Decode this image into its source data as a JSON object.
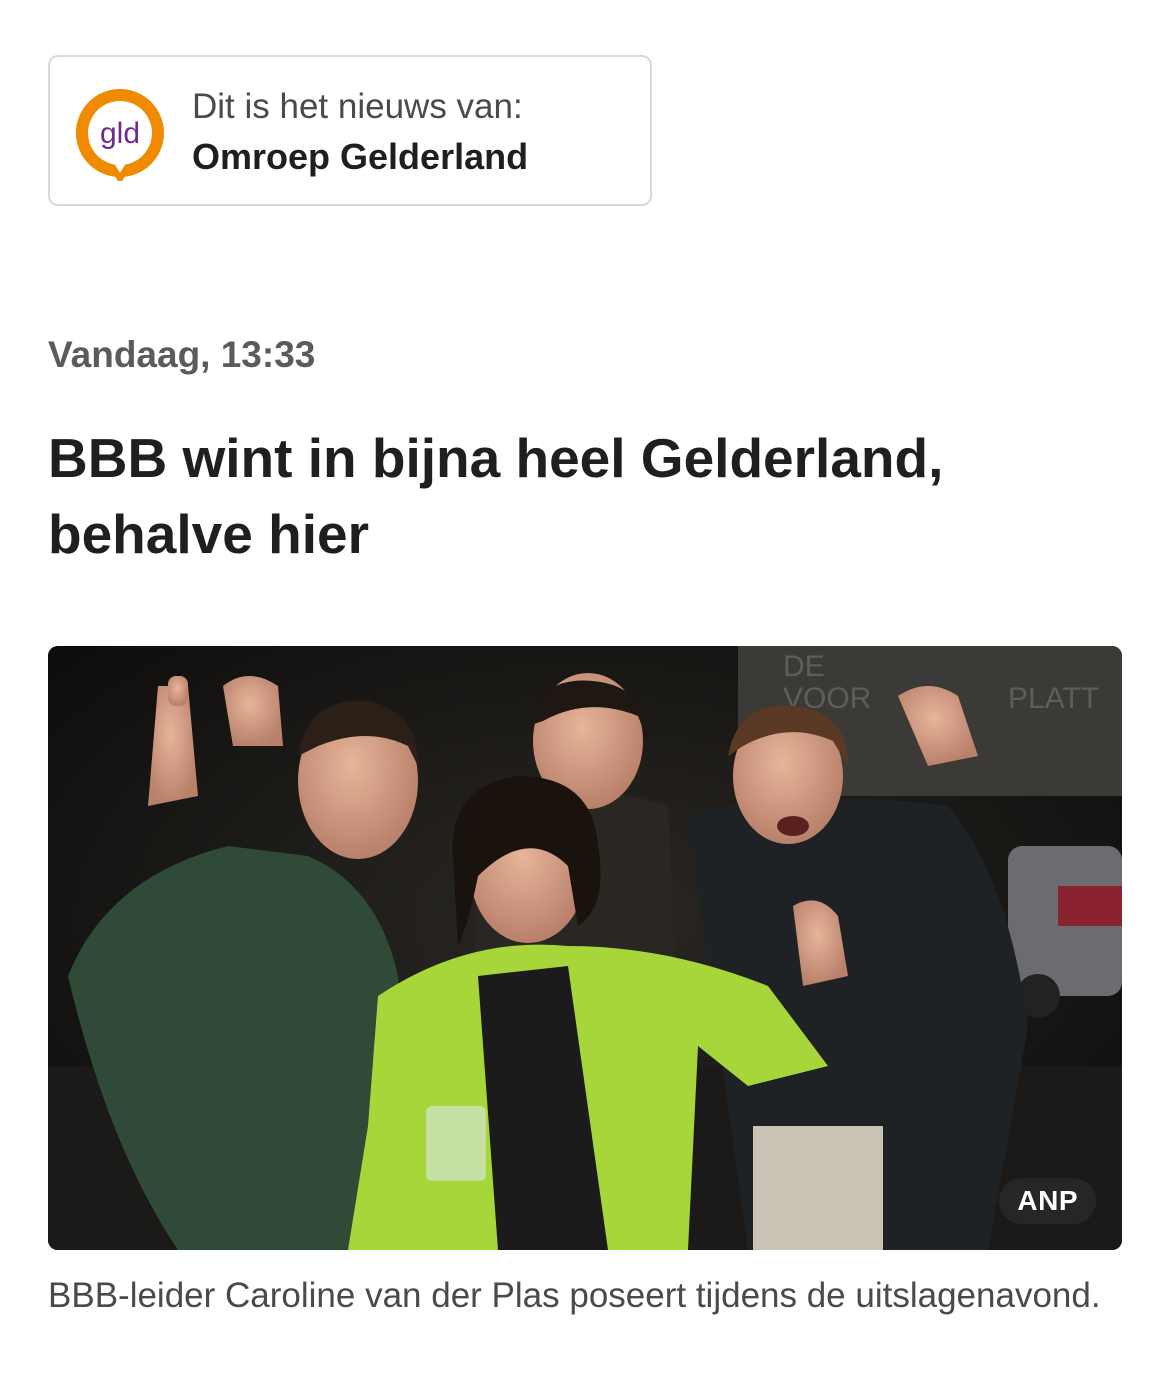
{
  "source": {
    "logo_text": "gld",
    "label": "Dit is het nieuws van:",
    "name": "Omroep Gelderland",
    "logo_ring_color": "#f08a00",
    "logo_text_color": "#6a2c91"
  },
  "article": {
    "timestamp": "Vandaag, 13:33",
    "headline": "BBB wint in bijna heel Gelderland, behalve hier",
    "photo": {
      "credit": "ANP",
      "sign_text_line1": "DE",
      "sign_text_line2": "VOOR",
      "sign_text_line3": "PLATT"
    },
    "caption": "BBB-leider Caroline van der Plas poseert tijdens de uitslagenavond."
  }
}
